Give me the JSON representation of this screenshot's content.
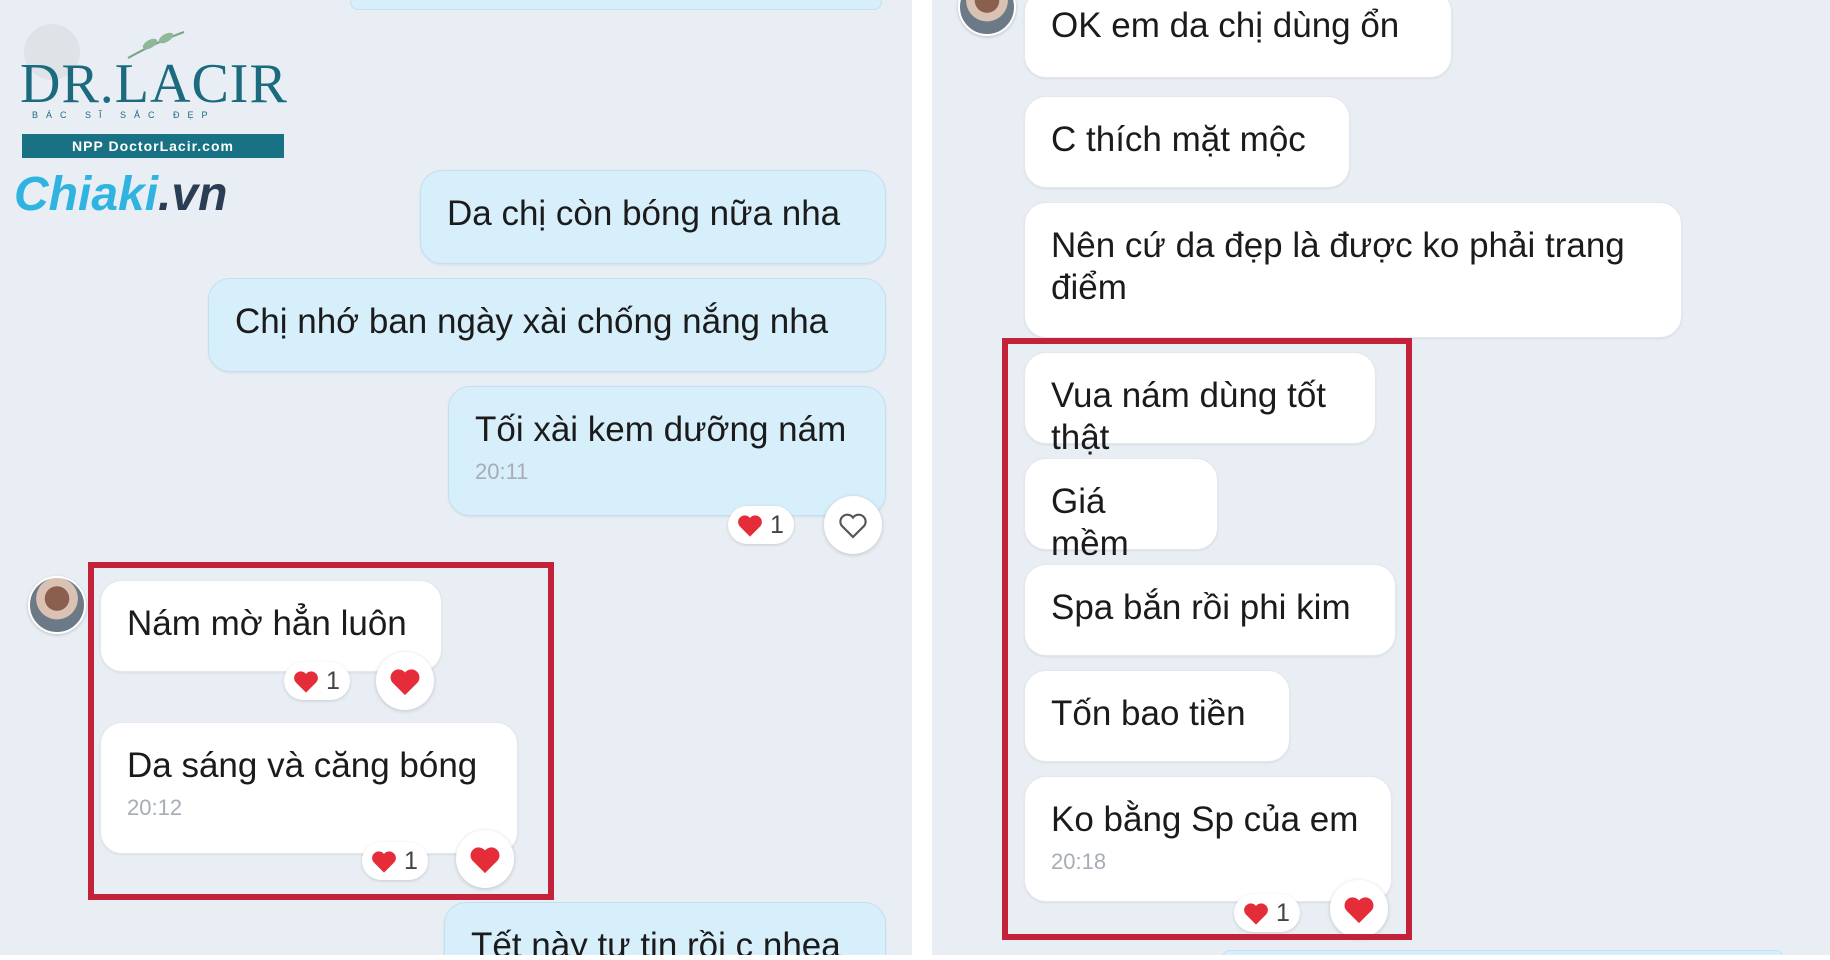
{
  "watermark": {
    "brand": "DR.LACIR",
    "tagline": "BÁC SĨ SẮC ĐẸP",
    "distributor": "NPP DoctorLacir.com",
    "site_name": "Chiaki",
    "site_tld": ".vn"
  },
  "left_chat": {
    "outgoing": [
      {
        "text": "Da chị còn bóng nữa nha"
      },
      {
        "text": "Chị nhớ ban ngày xài chống nắng nha"
      },
      {
        "text": "Tối xài kem dưỡng nám",
        "time": "20:11",
        "reaction_count": "1"
      },
      {
        "text": "Tết này tự tin rồi c nhea"
      }
    ],
    "incoming": [
      {
        "text": "Nám mờ hẳn luôn",
        "reaction_count": "1"
      },
      {
        "text": "Da sáng và căng bóng",
        "time": "20:12",
        "reaction_count": "1"
      }
    ]
  },
  "right_chat": {
    "incoming": [
      {
        "text": "OK em da chị dùng ổn"
      },
      {
        "text": "C thích mặt mộc"
      },
      {
        "text": "Nên cứ da đẹp là được ko phải trang điểm"
      },
      {
        "text": "Vua nám dùng tốt thật"
      },
      {
        "text": "Giá mềm"
      },
      {
        "text": "Spa bắn rồi phi kim"
      },
      {
        "text": "Tốn bao tiền"
      },
      {
        "text": "Ko bằng Sp của em",
        "time": "20:18",
        "reaction_count": "1"
      }
    ]
  },
  "colors": {
    "background": "#e9eef5",
    "outgoing_bubble": "#d7eefb",
    "incoming_bubble": "#ffffff",
    "highlight_frame": "#c4223a",
    "heart": "#e52d3a"
  },
  "icons": [
    "heart-icon",
    "heart-outline-icon",
    "avatar"
  ]
}
